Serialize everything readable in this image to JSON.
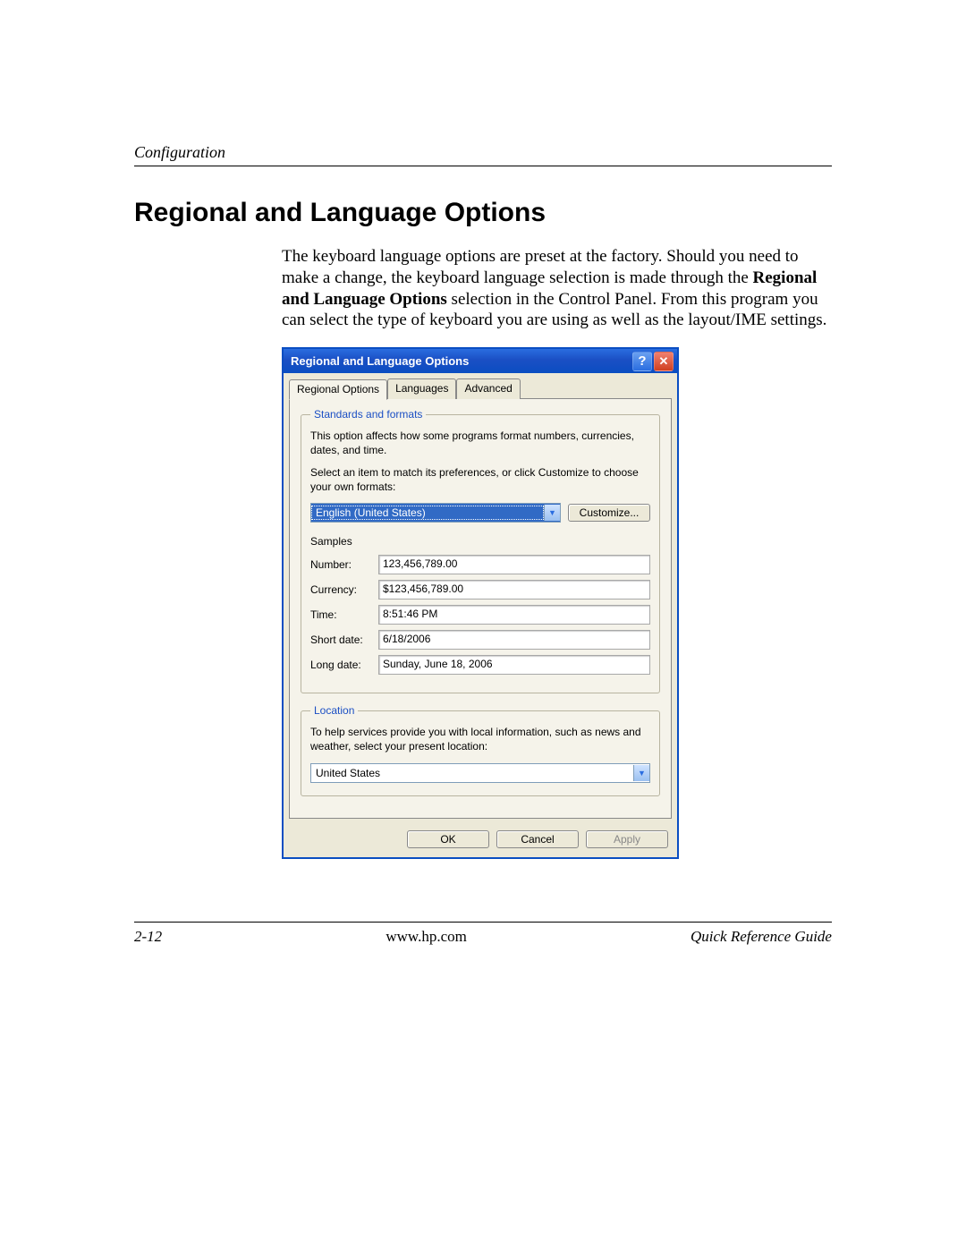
{
  "header": {
    "chapter": "Configuration"
  },
  "title": "Regional and Language Options",
  "body": {
    "p1a": "The keyboard language options are preset at the factory. Should you need to make a change, the keyboard language selection is made through the ",
    "p1bold": "Regional and Language Options",
    "p1b": " selection in the Control Panel. From this program you can select the type of keyboard you are using as well as the layout/IME settings."
  },
  "dialog": {
    "title": "Regional and Language Options",
    "tabs": {
      "t1": "Regional Options",
      "t2": "Languages",
      "t3": "Advanced"
    },
    "standards": {
      "legend": "Standards and formats",
      "desc": "This option affects how some programs format numbers, currencies, dates, and time.",
      "instruction": "Select an item to match its preferences, or click Customize to choose your own formats:",
      "selected": "English (United States)",
      "customize": "Customize...",
      "samples_label": "Samples",
      "samples": {
        "number_lbl": "Number:",
        "number_val": "123,456,789.00",
        "currency_lbl": "Currency:",
        "currency_val": "$123,456,789.00",
        "time_lbl": "Time:",
        "time_val": "8:51:46 PM",
        "shortdate_lbl": "Short date:",
        "shortdate_val": "6/18/2006",
        "longdate_lbl": "Long date:",
        "longdate_val": "Sunday, June 18, 2006"
      }
    },
    "location": {
      "legend": "Location",
      "desc": "To help services provide you with local information, such as news and weather, select your present location:",
      "selected": "United States"
    },
    "buttons": {
      "ok": "OK",
      "cancel": "Cancel",
      "apply": "Apply"
    }
  },
  "footer": {
    "pageno": "2-12",
    "url": "www.hp.com",
    "guide": "Quick Reference Guide"
  }
}
